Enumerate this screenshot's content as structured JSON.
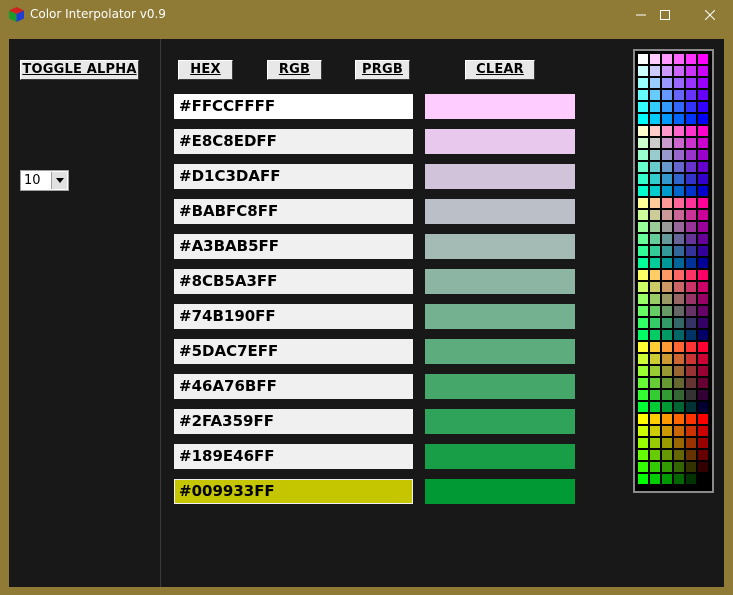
{
  "window": {
    "title": "Color Interpolator  v0.9",
    "icon": "cube-icon",
    "controls": {
      "minimize": "minimize-icon",
      "maximize": "maximize-icon",
      "close": "close-icon"
    }
  },
  "left": {
    "toggle_alpha_label": "TOGGLE ALPHA",
    "steps_value": "10"
  },
  "toolbar": {
    "hex_label": "HEX",
    "rgb_label": "RGB",
    "prgb_label": "PRGB",
    "clear_label": "CLEAR"
  },
  "colors": [
    {
      "hex": "#FFCCFFFF",
      "swatch": "#FFCCFF"
    },
    {
      "hex": "#E8C8EDFF",
      "swatch": "#E8C8ED"
    },
    {
      "hex": "#D1C3DAFF",
      "swatch": "#D1C3DA"
    },
    {
      "hex": "#BABFC8FF",
      "swatch": "#BABFC8"
    },
    {
      "hex": "#A3BAB5FF",
      "swatch": "#A3BAB5"
    },
    {
      "hex": "#8CB5A3FF",
      "swatch": "#8CB5A3"
    },
    {
      "hex": "#74B190FF",
      "swatch": "#74B190"
    },
    {
      "hex": "#5DAC7EFF",
      "swatch": "#5DAC7E"
    },
    {
      "hex": "#46A76BFF",
      "swatch": "#46A76B"
    },
    {
      "hex": "#2FA359FF",
      "swatch": "#2FA359"
    },
    {
      "hex": "#189E46FF",
      "swatch": "#189E46"
    },
    {
      "hex": "#009933FF",
      "swatch": "#009933"
    }
  ],
  "palette": {
    "red_levels": [
      "FF",
      "CC",
      "99",
      "66",
      "33",
      "00"
    ],
    "green_levels": [
      "FF",
      "CC",
      "99",
      "66",
      "33",
      "00"
    ],
    "blue_levels": [
      "FF",
      "CC",
      "99",
      "66",
      "33",
      "00"
    ]
  }
}
